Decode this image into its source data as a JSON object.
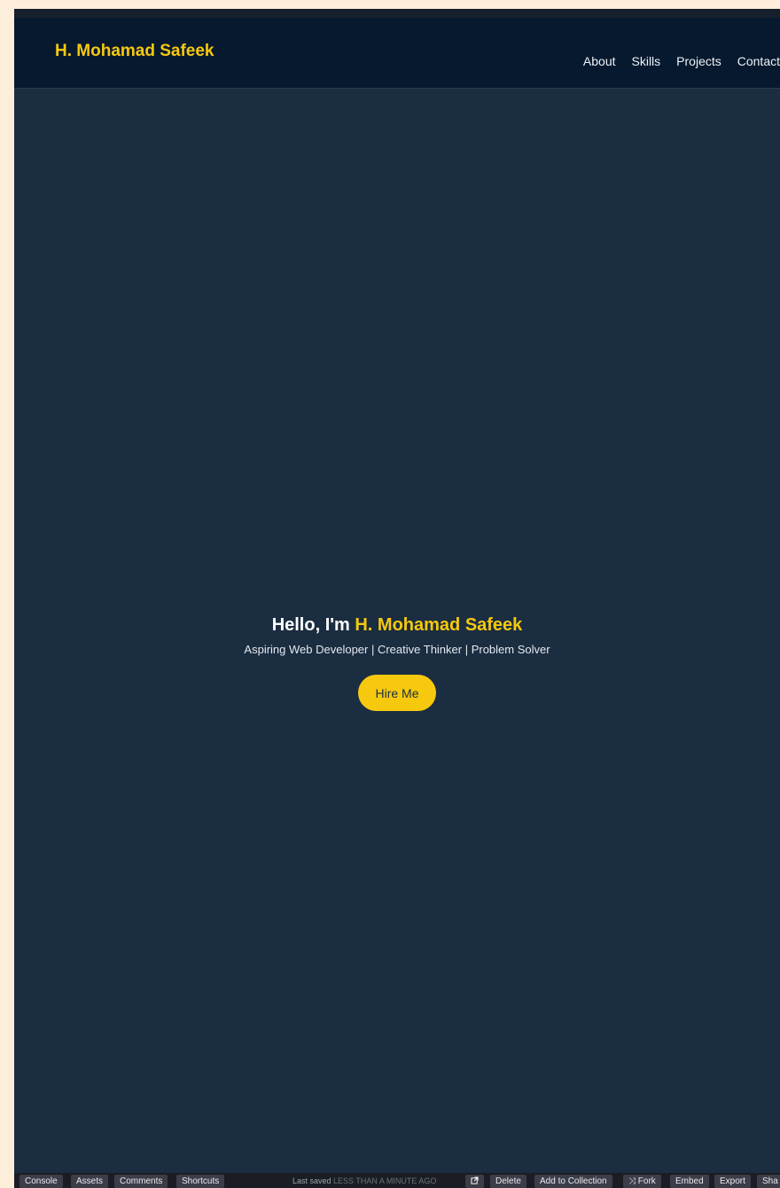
{
  "header": {
    "logo": "H. Mohamad Safeek",
    "nav": [
      "About",
      "Skills",
      "Projects",
      "Contact"
    ]
  },
  "hero": {
    "greeting": "Hello, I'm",
    "name": "H. Mohamad Safeek",
    "tagline": "Aspiring Web Developer | Creative Thinker | Problem Solver",
    "cta": "Hire Me"
  },
  "editor_bar": {
    "left": [
      "Console",
      "Assets",
      "Comments",
      "Shortcuts"
    ],
    "status_prefix": "Last saved",
    "status_time": "LESS THAN A MINUTE AGO",
    "open_icon": "external-link-icon",
    "right": {
      "delete": "Delete",
      "add_to_collection": "Add to Collection",
      "fork": "Fork",
      "embed": "Embed",
      "export": "Export",
      "share": "Sha"
    }
  },
  "colors": {
    "accent": "#f7c90e",
    "background": "#1b2d41",
    "header": "#06192f",
    "outer": "#fdeedb"
  }
}
